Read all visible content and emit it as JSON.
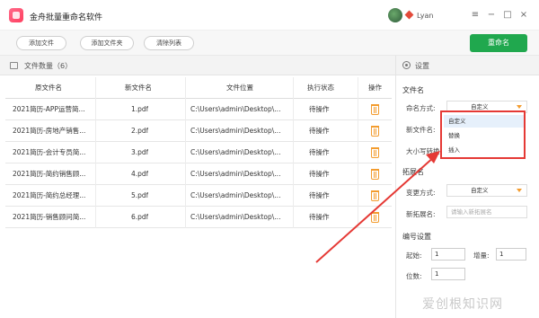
{
  "app": {
    "title": "金舟批量重命名软件",
    "user_name": "Lyan"
  },
  "window_controls": {
    "menu": "≡",
    "minimize": "−",
    "maximize": "□",
    "close": "×"
  },
  "toolbar": {
    "add_file": "添加文件",
    "add_folder": "添加文件夹",
    "clear_list": "清除列表",
    "rename": "重命名"
  },
  "file_list": {
    "title": "文件数量（6）",
    "columns": [
      "原文件名",
      "新文件名",
      "文件位置",
      "执行状态",
      "操作"
    ],
    "rows": [
      {
        "original": "2021简历-APP运营简...",
        "new": "1.pdf",
        "location": "C:\\Users\\admin\\Desktop\\...",
        "status": "待操作"
      },
      {
        "original": "2021简历-房地产销售...",
        "new": "2.pdf",
        "location": "C:\\Users\\admin\\Desktop\\...",
        "status": "待操作"
      },
      {
        "original": "2021简历-会计专员简...",
        "new": "3.pdf",
        "location": "C:\\Users\\admin\\Desktop\\...",
        "status": "待操作"
      },
      {
        "original": "2021简历-简约销售顾...",
        "new": "4.pdf",
        "location": "C:\\Users\\admin\\Desktop\\...",
        "status": "待操作"
      },
      {
        "original": "2021简历-简约总经理...",
        "new": "5.pdf",
        "location": "C:\\Users\\admin\\Desktop\\...",
        "status": "待操作"
      },
      {
        "original": "2021简历-销售顾问简...",
        "new": "6.pdf",
        "location": "C:\\Users\\admin\\Desktop\\...",
        "status": "待操作"
      }
    ]
  },
  "settings": {
    "title": "设置",
    "filename_section": "文件名",
    "naming_mode_label": "命名方式:",
    "naming_mode_value": "自定义",
    "new_filename_label": "新文件名:",
    "case_label": "大小写转换:",
    "naming_options": [
      "自定义",
      "替换",
      "插入"
    ],
    "extension_section": "拓展名",
    "change_mode_label": "变更方式:",
    "change_mode_value": "自定义",
    "new_ext_label": "新拓展名:",
    "new_ext_placeholder": "请输入新拓展名",
    "numbering_section": "编号设置",
    "start_label": "起始:",
    "start_value": "1",
    "increment_label": "增量:",
    "increment_value": "1",
    "digits_label": "位数:",
    "digits_value": "1"
  },
  "watermark": "爱创根知识网",
  "colors": {
    "accent_green": "#20a84e",
    "annotation_red": "#e53935",
    "trash_orange": "#f39c2e"
  }
}
